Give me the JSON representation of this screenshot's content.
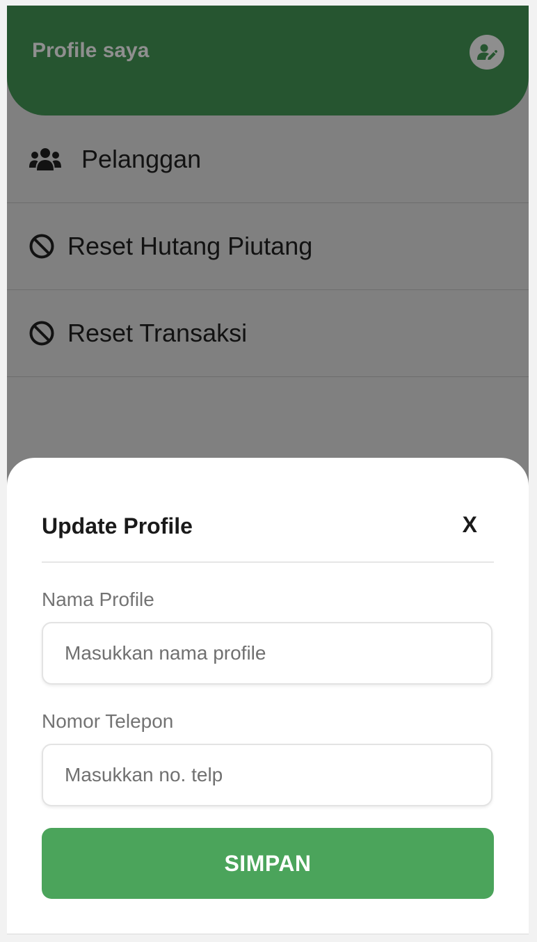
{
  "header": {
    "title": "Profile saya",
    "edit_icon": "user-edit-icon"
  },
  "menu": {
    "items": [
      {
        "label": "Pelanggan",
        "icon": "users-icon"
      },
      {
        "label": "Reset Hutang Piutang",
        "icon": "ban-icon"
      },
      {
        "label": "Reset Transaksi",
        "icon": "ban-icon"
      }
    ]
  },
  "modal": {
    "title": "Update Profile",
    "close_label": "X",
    "fields": [
      {
        "label": "Nama Profile",
        "placeholder": "Masukkan nama profile",
        "value": ""
      },
      {
        "label": "Nomor Telepon",
        "placeholder": "Masukkan no. telp",
        "value": ""
      }
    ],
    "submit_label": "SIMPAN"
  },
  "colors": {
    "header_bg": "#265530",
    "overlay_bg": "#808080",
    "submit_bg": "#4ba45b",
    "text_dark": "#121212"
  }
}
